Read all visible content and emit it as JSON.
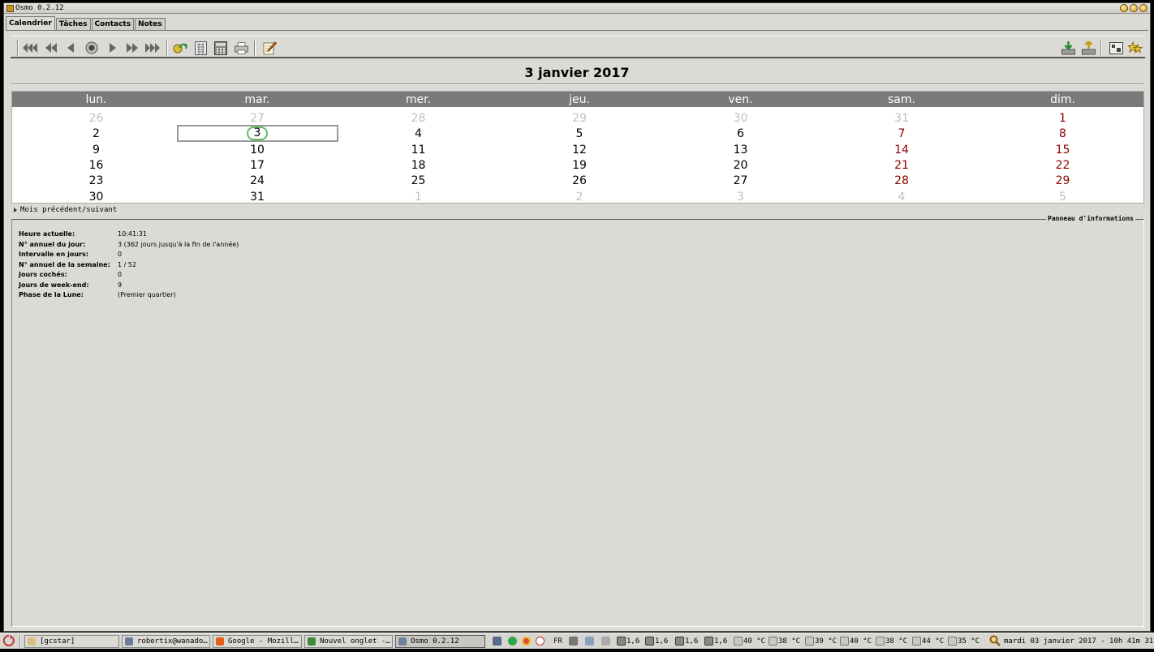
{
  "window": {
    "title": "Osmo 0.2.12"
  },
  "tabs": [
    {
      "label": "Calendrier",
      "active": true
    },
    {
      "label": "Tâches",
      "active": false
    },
    {
      "label": "Contacts",
      "active": false
    },
    {
      "label": "Notes",
      "active": false
    }
  ],
  "toolbar": {
    "left": [
      "prev-year-icon",
      "prev-month-icon",
      "prev-day-icon",
      "today-icon",
      "next-day-icon",
      "next-month-icon",
      "next-year-icon",
      "jump-to-date-icon",
      "fullyear-icon",
      "calculator-icon",
      "print-icon",
      "edit-note-icon"
    ],
    "right": [
      "import-icon",
      "export-icon",
      "settings-icon",
      "about-icon"
    ]
  },
  "date_header": "3 janvier 2017",
  "calendar": {
    "weekdays": [
      "lun.",
      "mar.",
      "mer.",
      "jeu.",
      "ven.",
      "sam.",
      "dim."
    ],
    "weeks": [
      [
        "26",
        "27",
        "28",
        "29",
        "30",
        "31",
        "1"
      ],
      [
        "2",
        "3",
        "4",
        "5",
        "6",
        "7",
        "8"
      ],
      [
        "9",
        "10",
        "11",
        "12",
        "13",
        "14",
        "15"
      ],
      [
        "16",
        "17",
        "18",
        "19",
        "20",
        "21",
        "22"
      ],
      [
        "23",
        "24",
        "25",
        "26",
        "27",
        "28",
        "29"
      ],
      [
        "30",
        "31",
        "1",
        "2",
        "3",
        "4",
        "5"
      ]
    ],
    "selected_day": "3",
    "colors": {
      "header_bg": "#7a7a7a",
      "weekend": "#8b0000",
      "other_month": "#c0c0c0",
      "today_ring": "#66bb66"
    }
  },
  "expander_label": "Mois précédent/suivant",
  "info_panel": {
    "title": "Panneau d'informations",
    "rows": [
      {
        "key": "Heure actuelle:",
        "value": "10:41:31"
      },
      {
        "key": "N° annuel du jour:",
        "value": "3 (362 jours jusqu'à la fin de l'année)"
      },
      {
        "key": "Intervalle en jours:",
        "value": "0"
      },
      {
        "key": "N° annuel de la semaine:",
        "value": "1 / 52"
      },
      {
        "key": "Jours cochés:",
        "value": "0"
      },
      {
        "key": "Jours de week-end:",
        "value": "9"
      },
      {
        "key": "Phase de la Lune:",
        "value": "(Premier quartier)"
      }
    ]
  },
  "taskbar": {
    "tasks": [
      {
        "label": "[gcstar]",
        "icon": "folder-icon",
        "color": "#d8c080"
      },
      {
        "label": "robertix@wanado…",
        "icon": "mail-icon",
        "color": "#6a7a9a"
      },
      {
        "label": "Google - Mozill…",
        "icon": "firefox-icon",
        "color": "#e0601a"
      },
      {
        "label": "Nouvel onglet -…",
        "icon": "chrome-icon",
        "color": "#3a8a3a"
      },
      {
        "label": "Osmo 0.2.12",
        "icon": "osmo-icon",
        "color": "#7080a0",
        "active": true
      }
    ],
    "keyboard_layout": "FR",
    "cpu_values": [
      "1,6",
      "1,6",
      "1,6",
      "1,6"
    ],
    "temperatures": [
      "40 °C",
      "38 °C",
      "39 °C",
      "40 °C",
      "38 °C",
      "44 °C",
      "35 °C"
    ],
    "clock": "mardi 03 janvier 2017 - 10h 41m 31s"
  }
}
